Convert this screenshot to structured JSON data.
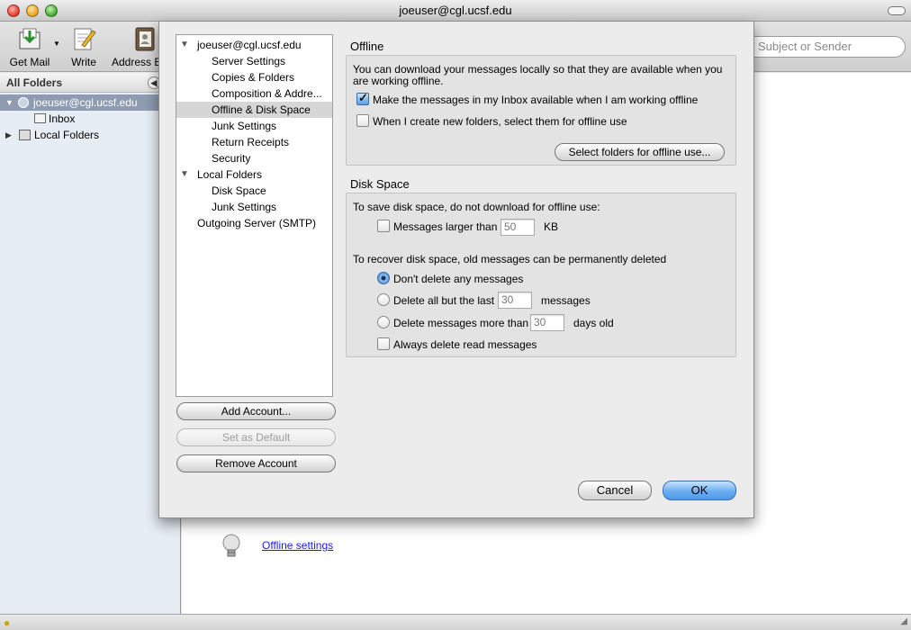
{
  "window": {
    "title": "joeuser@cgl.ucsf.edu"
  },
  "toolbar": {
    "get_mail": "Get Mail",
    "write": "Write",
    "address_book": "Address B",
    "search_placeholder": "Subject or Sender"
  },
  "sidebar": {
    "header": "All Folders",
    "account": "joeuser@cgl.ucsf.edu",
    "inbox": "Inbox",
    "local_folders": "Local Folders"
  },
  "content": {
    "offline_link": "Offline settings"
  },
  "dialog": {
    "tree": [
      "joeuser@cgl.ucsf.edu",
      "Server Settings",
      "Copies & Folders",
      "Composition & Addre...",
      "Offline & Disk Space",
      "Junk Settings",
      "Return Receipts",
      "Security",
      "Local Folders",
      "Disk Space",
      "Junk Settings",
      "Outgoing Server (SMTP)"
    ],
    "add_account": "Add Account...",
    "set_default": "Set as Default",
    "remove_account": "Remove Account",
    "offline": {
      "title": "Offline",
      "desc_line1": "You can download your messages locally so that they are available when you",
      "desc_line2": "are working offline.",
      "inbox_offline": "Make the messages in my Inbox available when I am working offline",
      "inbox_offline_checked": true,
      "new_folders": "When I create new folders, select them for offline use",
      "new_folders_checked": false,
      "select_folders_button": "Select folders for offline use..."
    },
    "disk_space": {
      "title": "Disk Space",
      "save_intro": "To save disk space, do not download for offline use:",
      "larger_than": "Messages larger than",
      "larger_than_value": "50",
      "kb": "KB",
      "recover_intro": "To recover disk space, old messages can be permanently deleted",
      "dont_delete": "Don't delete any messages",
      "delete_all_but": "Delete all but the last",
      "delete_all_but_value": "30",
      "messages": "messages",
      "delete_older": "Delete messages more than",
      "delete_older_value": "30",
      "days_old": "days old",
      "always_delete_read": "Always delete read messages"
    },
    "cancel": "Cancel",
    "ok": "OK"
  }
}
